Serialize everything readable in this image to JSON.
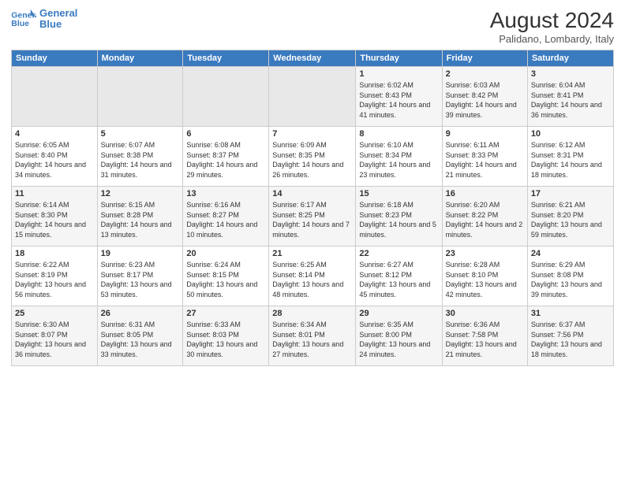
{
  "header": {
    "logo_line1": "General",
    "logo_line2": "Blue",
    "title": "August 2024",
    "subtitle": "Palidano, Lombardy, Italy"
  },
  "days_of_week": [
    "Sunday",
    "Monday",
    "Tuesday",
    "Wednesday",
    "Thursday",
    "Friday",
    "Saturday"
  ],
  "weeks": [
    [
      {
        "day": "",
        "content": ""
      },
      {
        "day": "",
        "content": ""
      },
      {
        "day": "",
        "content": ""
      },
      {
        "day": "",
        "content": ""
      },
      {
        "day": "1",
        "content": "Sunrise: 6:02 AM\nSunset: 8:43 PM\nDaylight: 14 hours and 41 minutes."
      },
      {
        "day": "2",
        "content": "Sunrise: 6:03 AM\nSunset: 8:42 PM\nDaylight: 14 hours and 39 minutes."
      },
      {
        "day": "3",
        "content": "Sunrise: 6:04 AM\nSunset: 8:41 PM\nDaylight: 14 hours and 36 minutes."
      }
    ],
    [
      {
        "day": "4",
        "content": "Sunrise: 6:05 AM\nSunset: 8:40 PM\nDaylight: 14 hours and 34 minutes."
      },
      {
        "day": "5",
        "content": "Sunrise: 6:07 AM\nSunset: 8:38 PM\nDaylight: 14 hours and 31 minutes."
      },
      {
        "day": "6",
        "content": "Sunrise: 6:08 AM\nSunset: 8:37 PM\nDaylight: 14 hours and 29 minutes."
      },
      {
        "day": "7",
        "content": "Sunrise: 6:09 AM\nSunset: 8:35 PM\nDaylight: 14 hours and 26 minutes."
      },
      {
        "day": "8",
        "content": "Sunrise: 6:10 AM\nSunset: 8:34 PM\nDaylight: 14 hours and 23 minutes."
      },
      {
        "day": "9",
        "content": "Sunrise: 6:11 AM\nSunset: 8:33 PM\nDaylight: 14 hours and 21 minutes."
      },
      {
        "day": "10",
        "content": "Sunrise: 6:12 AM\nSunset: 8:31 PM\nDaylight: 14 hours and 18 minutes."
      }
    ],
    [
      {
        "day": "11",
        "content": "Sunrise: 6:14 AM\nSunset: 8:30 PM\nDaylight: 14 hours and 15 minutes."
      },
      {
        "day": "12",
        "content": "Sunrise: 6:15 AM\nSunset: 8:28 PM\nDaylight: 14 hours and 13 minutes."
      },
      {
        "day": "13",
        "content": "Sunrise: 6:16 AM\nSunset: 8:27 PM\nDaylight: 14 hours and 10 minutes."
      },
      {
        "day": "14",
        "content": "Sunrise: 6:17 AM\nSunset: 8:25 PM\nDaylight: 14 hours and 7 minutes."
      },
      {
        "day": "15",
        "content": "Sunrise: 6:18 AM\nSunset: 8:23 PM\nDaylight: 14 hours and 5 minutes."
      },
      {
        "day": "16",
        "content": "Sunrise: 6:20 AM\nSunset: 8:22 PM\nDaylight: 14 hours and 2 minutes."
      },
      {
        "day": "17",
        "content": "Sunrise: 6:21 AM\nSunset: 8:20 PM\nDaylight: 13 hours and 59 minutes."
      }
    ],
    [
      {
        "day": "18",
        "content": "Sunrise: 6:22 AM\nSunset: 8:19 PM\nDaylight: 13 hours and 56 minutes."
      },
      {
        "day": "19",
        "content": "Sunrise: 6:23 AM\nSunset: 8:17 PM\nDaylight: 13 hours and 53 minutes."
      },
      {
        "day": "20",
        "content": "Sunrise: 6:24 AM\nSunset: 8:15 PM\nDaylight: 13 hours and 50 minutes."
      },
      {
        "day": "21",
        "content": "Sunrise: 6:25 AM\nSunset: 8:14 PM\nDaylight: 13 hours and 48 minutes."
      },
      {
        "day": "22",
        "content": "Sunrise: 6:27 AM\nSunset: 8:12 PM\nDaylight: 13 hours and 45 minutes."
      },
      {
        "day": "23",
        "content": "Sunrise: 6:28 AM\nSunset: 8:10 PM\nDaylight: 13 hours and 42 minutes."
      },
      {
        "day": "24",
        "content": "Sunrise: 6:29 AM\nSunset: 8:08 PM\nDaylight: 13 hours and 39 minutes."
      }
    ],
    [
      {
        "day": "25",
        "content": "Sunrise: 6:30 AM\nSunset: 8:07 PM\nDaylight: 13 hours and 36 minutes."
      },
      {
        "day": "26",
        "content": "Sunrise: 6:31 AM\nSunset: 8:05 PM\nDaylight: 13 hours and 33 minutes."
      },
      {
        "day": "27",
        "content": "Sunrise: 6:33 AM\nSunset: 8:03 PM\nDaylight: 13 hours and 30 minutes."
      },
      {
        "day": "28",
        "content": "Sunrise: 6:34 AM\nSunset: 8:01 PM\nDaylight: 13 hours and 27 minutes."
      },
      {
        "day": "29",
        "content": "Sunrise: 6:35 AM\nSunset: 8:00 PM\nDaylight: 13 hours and 24 minutes."
      },
      {
        "day": "30",
        "content": "Sunrise: 6:36 AM\nSunset: 7:58 PM\nDaylight: 13 hours and 21 minutes."
      },
      {
        "day": "31",
        "content": "Sunrise: 6:37 AM\nSunset: 7:56 PM\nDaylight: 13 hours and 18 minutes."
      }
    ]
  ]
}
